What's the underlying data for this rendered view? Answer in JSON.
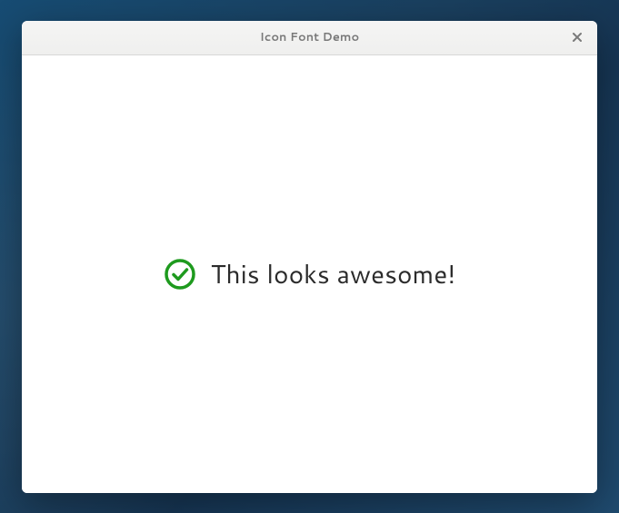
{
  "window": {
    "title": "Icon Font Demo"
  },
  "content": {
    "message": "This looks awesome!"
  },
  "colors": {
    "accent_green": "#1e9a1e"
  }
}
